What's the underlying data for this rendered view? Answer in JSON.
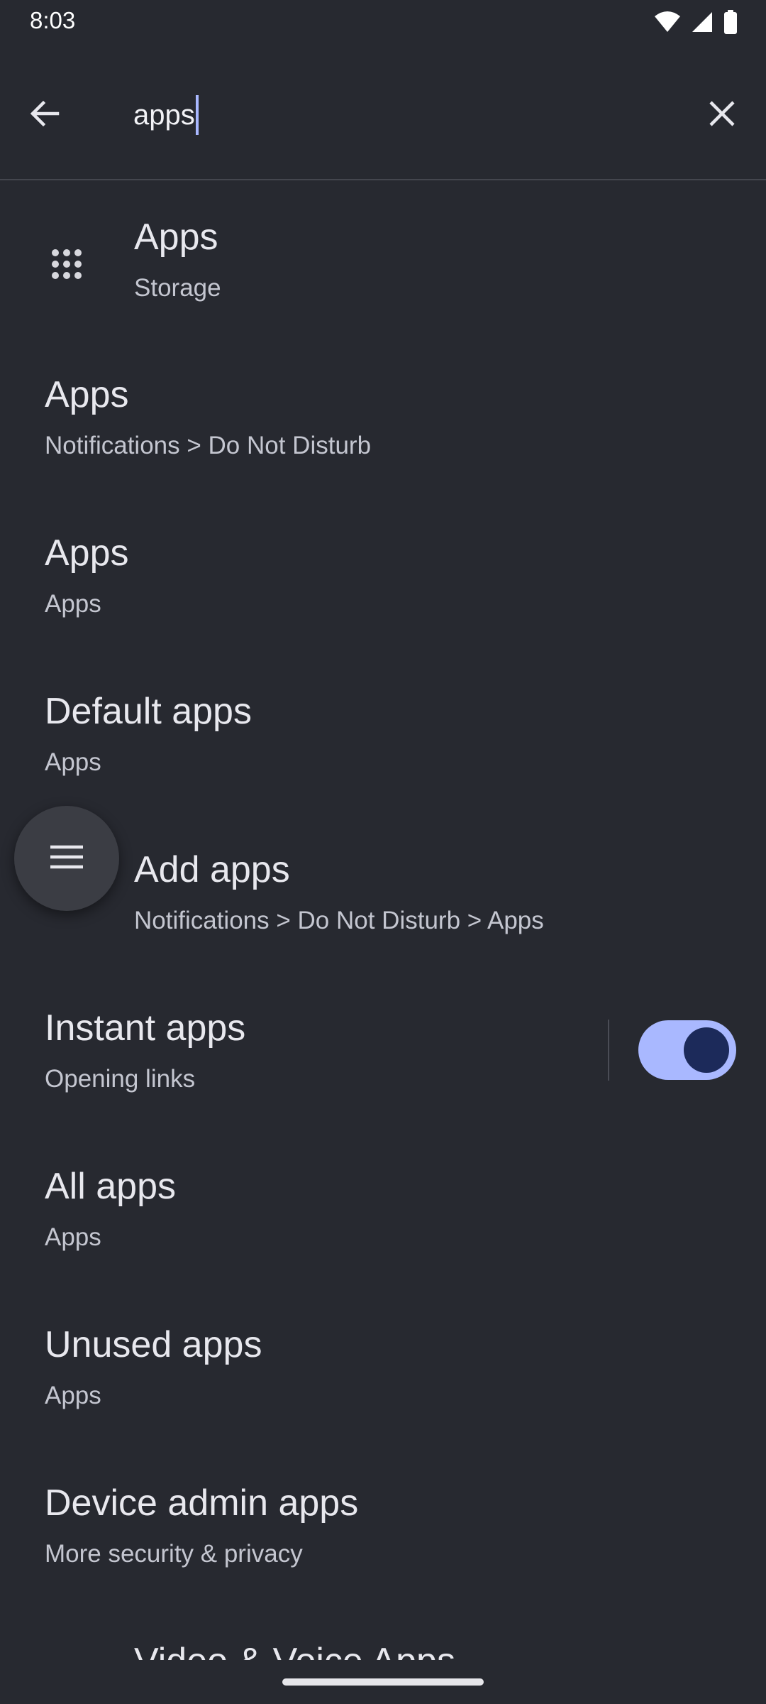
{
  "status_bar": {
    "time": "8:03",
    "icons": [
      "wifi-icon",
      "cellular-signal-icon",
      "battery-icon"
    ]
  },
  "search": {
    "query": "apps",
    "back_icon": "arrow-back-icon",
    "clear_icon": "close-icon"
  },
  "results": [
    {
      "title": "Apps",
      "subtitle": "Storage",
      "icon": "apps-grid-icon"
    },
    {
      "title": "Apps",
      "subtitle": "Notifications > Do Not Disturb"
    },
    {
      "title": "Apps",
      "subtitle": "Apps"
    },
    {
      "title": "Default apps",
      "subtitle": "Apps"
    },
    {
      "title": "Add apps",
      "subtitle": "Notifications > Do Not Disturb > Apps"
    },
    {
      "title": "Instant apps",
      "subtitle": "Opening links",
      "toggle_on": true
    },
    {
      "title": "All apps",
      "subtitle": "Apps"
    },
    {
      "title": "Unused apps",
      "subtitle": "Apps"
    },
    {
      "title": "Device admin apps",
      "subtitle": "More security & privacy"
    },
    {
      "title": "Video & Voice Apps",
      "subtitle": ""
    }
  ],
  "floating_button": {
    "icon": "menu-icon"
  },
  "colors": {
    "background": "#272930",
    "accent": "#a9b8ff",
    "toggle_thumb": "#1c2a5a"
  }
}
